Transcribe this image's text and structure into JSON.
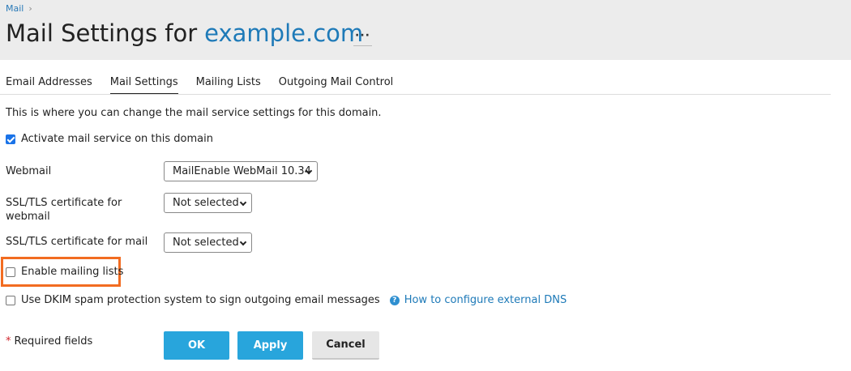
{
  "breadcrumb": {
    "item": "Mail"
  },
  "header": {
    "title_prefix": "Mail Settings for",
    "domain": "example.com",
    "more": "···"
  },
  "tabs": [
    {
      "label": "Email Addresses",
      "active": false
    },
    {
      "label": "Mail Settings",
      "active": true
    },
    {
      "label": "Mailing Lists",
      "active": false
    },
    {
      "label": "Outgoing Mail Control",
      "active": false
    }
  ],
  "form": {
    "description": "This is where you can change the mail service settings for this domain.",
    "activate_label": "Activate mail service on this domain",
    "activate_checked": true,
    "webmail_label": "Webmail",
    "webmail_value": "MailEnable WebMail 10.34",
    "ssl_webmail_label": "SSL/TLS certificate for webmail",
    "ssl_webmail_value": "Not selected",
    "ssl_mail_label": "SSL/TLS certificate for mail",
    "ssl_mail_value": "Not selected",
    "mailing_lists_label": "Enable mailing lists",
    "mailing_lists_checked": false,
    "dkim_label": "Use DKIM spam protection system to sign outgoing email messages",
    "dkim_checked": false,
    "dns_link": "How to configure external DNS",
    "required_note": "Required fields",
    "required_star": "*"
  },
  "buttons": {
    "ok": "OK",
    "apply": "Apply",
    "cancel": "Cancel"
  },
  "colors": {
    "accent": "#28a5dc",
    "link": "#1e7ab8",
    "highlight": "#f26c21",
    "checkbox": "#1a73e8"
  }
}
